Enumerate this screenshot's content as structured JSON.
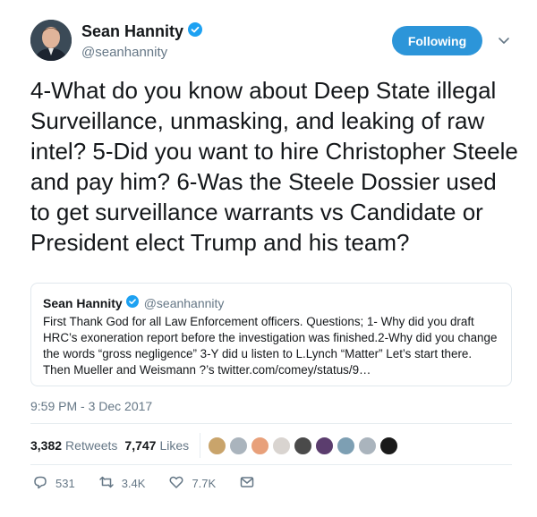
{
  "author": {
    "display_name": "Sean Hannity",
    "handle": "@seanhannity",
    "verified_icon": "verified-badge-icon"
  },
  "follow_button": {
    "label": "Following",
    "color": "#2c95d9"
  },
  "tweet": {
    "text": "4-What do you know about Deep State illegal Surveillance, unmasking, and leaking of raw intel? 5-Did you want to hire Christopher Steele and pay him? 6-Was the Steele Dossier used to get surveillance warrants vs Candidate or President elect Trump and his team?",
    "timestamp": "9:59 PM - 3 Dec 2017"
  },
  "quoted_tweet": {
    "display_name": "Sean Hannity",
    "handle": "@seanhannity",
    "text": "First Thank God for all Law Enforcement officers. Questions; 1- Why did you draft HRC’s exoneration report before the investigation was finished.2-Why did you change the words “gross negligence” 3-Y did u listen to L.Lynch “Matter” Let’s start there. Then Mueller and Weismann ?’s twitter.com/comey/status/9…"
  },
  "stats": {
    "retweets_count": "3,382",
    "retweets_label": "Retweets",
    "likes_count": "7,747",
    "likes_label": "Likes"
  },
  "liker_avatars": [
    "#c9a46b",
    "#aab4bd",
    "#e8a07a",
    "#d9d4d0",
    "#4a4a4a",
    "#5b3d6e",
    "#7d9fb3",
    "#aab4bd",
    "#1a1a1a"
  ],
  "actions": {
    "reply_count": "531",
    "retweet_count": "3.4K",
    "like_count": "7.7K"
  }
}
